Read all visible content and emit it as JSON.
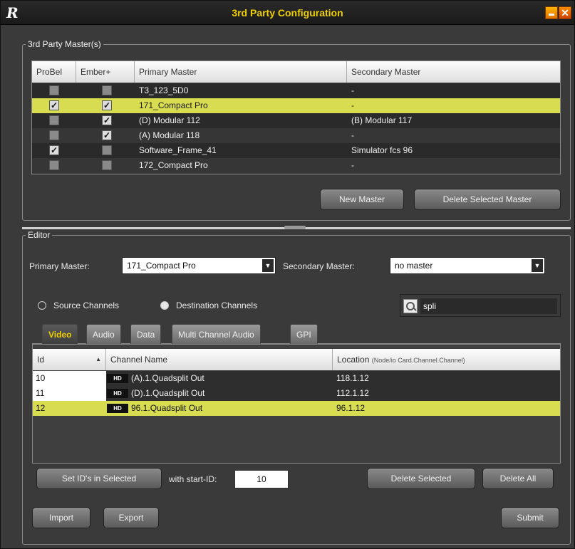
{
  "window": {
    "title": "3rd Party Configuration",
    "logo": "R",
    "close_glyph": "✕"
  },
  "masters": {
    "legend": "3rd Party Master(s)",
    "columns": [
      "ProBel",
      "Ember+",
      "Primary Master",
      "Secondary Master"
    ],
    "rows": [
      {
        "probel": false,
        "ember": false,
        "primary": "T3_123_5D0",
        "secondary": "-"
      },
      {
        "probel": true,
        "ember": true,
        "primary": "171_Compact Pro",
        "secondary": "-",
        "selected": true
      },
      {
        "probel": false,
        "ember": true,
        "primary": "(D) Modular 112",
        "secondary": "(B) Modular 117"
      },
      {
        "probel": false,
        "ember": true,
        "primary": "(A) Modular 118",
        "secondary": "-"
      },
      {
        "probel": true,
        "ember": false,
        "primary": "Software_Frame_41",
        "secondary": "Simulator fcs 96"
      },
      {
        "probel": false,
        "ember": false,
        "primary": "172_Compact Pro",
        "secondary": "-"
      }
    ],
    "new_master_label": "New Master",
    "delete_master_label": "Delete Selected Master"
  },
  "editor": {
    "legend": "Editor",
    "primary_label": "Primary Master:",
    "primary_value": "171_Compact Pro",
    "secondary_label": "Secondary Master:",
    "secondary_value": "no master",
    "source_label": "Source Channels",
    "destination_label": "Destination Channels",
    "channel_mode": "destination",
    "filter_value": "spli",
    "tabs": [
      "Video",
      "Audio",
      "Data",
      "Multi Channel Audio",
      "GPI"
    ],
    "active_tab": "Video",
    "channel_columns": {
      "id": "Id",
      "name": "Channel Name",
      "location": "Location",
      "location_sub": "(Node/io Card.Channel.Channel)"
    },
    "channels": [
      {
        "id": "10",
        "badge": "HD",
        "name": "(A).1.Quadsplit Out",
        "location": "118.1.12"
      },
      {
        "id": "11",
        "badge": "HD",
        "name": "(D).1.Quadsplit Out",
        "location": "112.1.12"
      },
      {
        "id": "12",
        "badge": "HD",
        "name": "96.1.Quadsplit Out",
        "location": "96.1.12",
        "selected": true
      }
    ],
    "set_ids_label": "Set ID's in Selected",
    "start_id_label": "with start-ID:",
    "start_id_value": "10",
    "delete_selected_label": "Delete Selected",
    "delete_all_label": "Delete All",
    "import_label": "Import",
    "export_label": "Export",
    "submit_label": "Submit"
  }
}
